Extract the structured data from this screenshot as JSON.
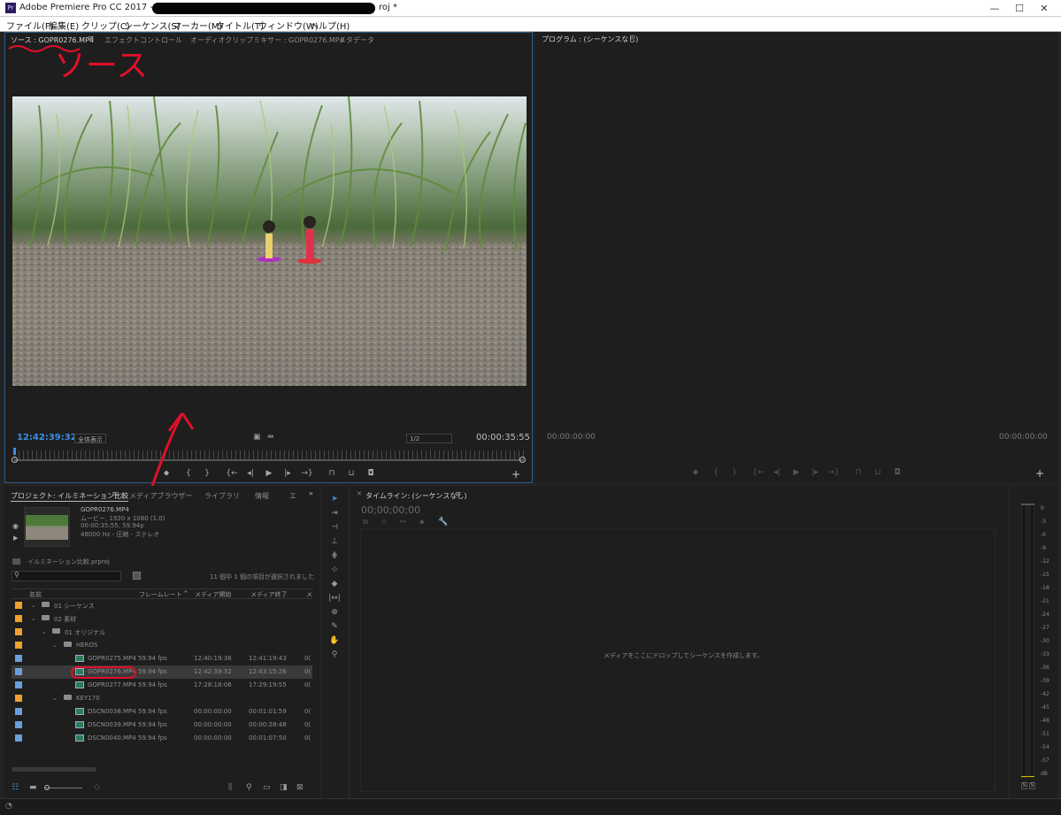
{
  "window": {
    "title_prefix": "Adobe Premiere Pro CC 2017 - D:¥F",
    "title_suffix": "roj *",
    "app_icon": "Pr",
    "minimize": "—",
    "maximize": "☐",
    "close": "✕"
  },
  "menu": [
    "ファイル(F)",
    "編集(E)",
    "クリップ(C)",
    "シーケンス(S)",
    "マーカー(M)",
    "タイトル(T)",
    "ウィンドウ(W)",
    "ヘルプ(H)"
  ],
  "source": {
    "tabs": [
      "ソース : GOPR0276.MP4",
      "エフェクトコントロール",
      "オーディオクリップミキサー : GOPR0276.MP4",
      "メタデータ"
    ],
    "annotation": "ソース",
    "timecode": "12:42:39:32",
    "fit": "全体表示",
    "resolution": "1/2",
    "duration": "00:00:35:55"
  },
  "program": {
    "tab": "プログラム : (シーケンスなし)",
    "timecode_left": "00:00:00:00",
    "timecode_right": "00:00:00:00"
  },
  "project": {
    "tabs": [
      "プロジェクト: イルミネーション比較",
      "メディアブラウザー",
      "ライブラリ",
      "情報",
      "エ"
    ],
    "preview": {
      "name": "GOPR0276.MP4",
      "line1": "ムービー, 1920 x 1080 (1.0)",
      "line2": "00:00:35:55, 59.94p",
      "line3": "48000 Hz - 圧縮 - ステレオ"
    },
    "project_file": "イルミネーション比較.prproj",
    "selection_info": "11 個中 1 個の項目が選択されました",
    "columns": [
      "名前",
      "フレームレート",
      "メディア開始",
      "メディア終了",
      "メ"
    ],
    "rows": [
      {
        "name": "01 シーケンス",
        "fps": "",
        "start": "",
        "end": "",
        "extra": ""
      },
      {
        "name": "02 素材",
        "fps": "",
        "start": "",
        "end": "",
        "extra": ""
      },
      {
        "name": "01 オリジナル",
        "fps": "",
        "start": "",
        "end": "",
        "extra": ""
      },
      {
        "name": "HEROS",
        "fps": "",
        "start": "",
        "end": "",
        "extra": ""
      },
      {
        "name": "GOPR0275.MP4",
        "fps": "59.94 fps",
        "start": "12:40:19:36",
        "end": "12:41:19:43",
        "extra": "0("
      },
      {
        "name": "GOPR0276.MP4",
        "fps": "59.94 fps",
        "start": "12:42:39:32",
        "end": "12:43:15:26",
        "extra": "0("
      },
      {
        "name": "GOPR0277.MP4",
        "fps": "59.94 fps",
        "start": "17:28:18:06",
        "end": "17:29:19:55",
        "extra": "0("
      },
      {
        "name": "KEY170",
        "fps": "",
        "start": "",
        "end": "",
        "extra": ""
      },
      {
        "name": "DSCN0038.MP4",
        "fps": "59.94 fps",
        "start": "00:00:00:00",
        "end": "00:01:01:59",
        "extra": "0("
      },
      {
        "name": "DSCN0039.MP4",
        "fps": "59.94 fps",
        "start": "00:00:00:00",
        "end": "00:00:28:48",
        "extra": "0("
      },
      {
        "name": "DSCN0040.MP4",
        "fps": "59.94 fps",
        "start": "00:00:00:00",
        "end": "00:01:07:50",
        "extra": "0("
      }
    ]
  },
  "timeline": {
    "tab": "タイムライン: (シーケンスなし)",
    "timecode": "00;00;00;00",
    "drop_hint": "メディアをここにドロップしてシーケンスを作成します。"
  },
  "meter": {
    "scale": [
      "0",
      "-3",
      "-6",
      "-9",
      "-12",
      "-15",
      "-18",
      "-21",
      "-24",
      "-27",
      "-30",
      "-33",
      "-36",
      "-39",
      "-42",
      "-45",
      "-48",
      "-51",
      "-54",
      "-57",
      "dB"
    ],
    "solo_left": "S",
    "solo_right": "S"
  },
  "colors": {
    "folder_swatch": "#f0a030",
    "clip_swatch": "#6a9fd8",
    "annotation_red": "#e0102a",
    "timecode_blue": "#3d8ee6"
  }
}
